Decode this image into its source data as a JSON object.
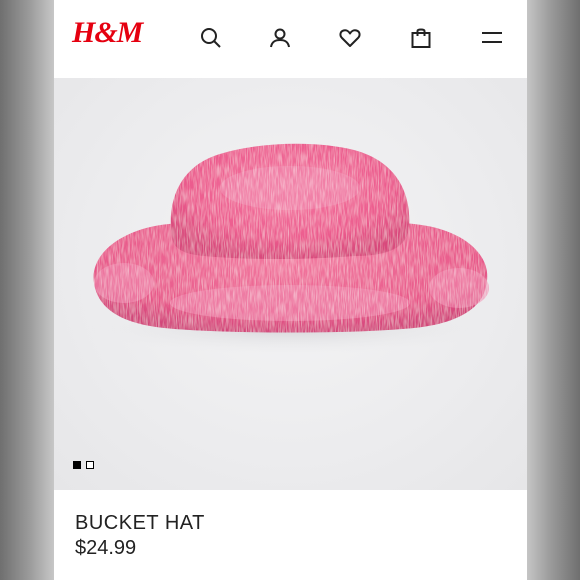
{
  "header": {
    "logo_text": "H&M",
    "brand_color": "#e50010",
    "icons": [
      "search-icon",
      "account-icon",
      "favorites-heart-icon",
      "shopping-bag-icon",
      "menu-icon"
    ]
  },
  "gallery": {
    "image_description_icon": "pink-fluffy-bucket-hat",
    "image_count": 2,
    "active_index": 0,
    "hat_color": "#f0709a"
  },
  "product": {
    "name": "BUCKET HAT",
    "price": "$24.99"
  }
}
